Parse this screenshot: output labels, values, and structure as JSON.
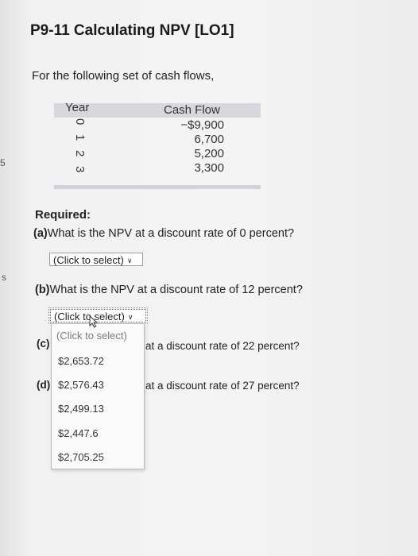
{
  "margin_marks": {
    "left_top": "5",
    "left_bottom": "s"
  },
  "title": "P9-11 Calculating NPV [LO1]",
  "intro": "For the following set of cash flows,",
  "cash_flows": {
    "headers": {
      "year": "Year",
      "flow": "Cash Flow"
    },
    "years": [
      "0",
      "1",
      "2",
      "3"
    ],
    "values": [
      "−$9,900",
      "6,700",
      "5,200",
      "3,300"
    ]
  },
  "required": "Required:",
  "questions": {
    "a": {
      "label": "(a)",
      "text": "What is the NPV at a discount rate of 0 percent?",
      "select_value": "(Click to select)"
    },
    "b": {
      "label": "(b)",
      "text": "What is the NPV at a discount rate of 12 percent?",
      "select_value": "(Click to select)"
    },
    "c": {
      "label": "(c)",
      "text": "at a discount rate of 22 percent?"
    },
    "d": {
      "label": "(d)",
      "text": "at a discount rate of 27 percent?"
    }
  },
  "dropdown_options": [
    "(Click to select)",
    "$2,653.72",
    "$2,576.43",
    "$2,499.13",
    "$2,447.6",
    "$2,705.25"
  ]
}
